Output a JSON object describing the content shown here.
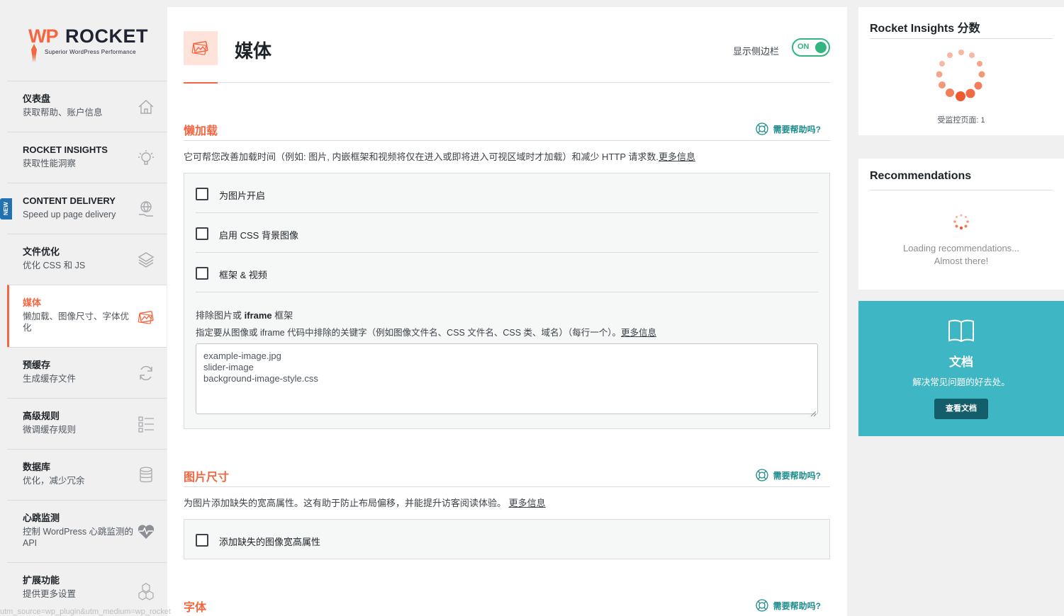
{
  "logo": {
    "wp": "WP",
    "rocket": "ROCKET",
    "tagline": "Superior WordPress Performance"
  },
  "sidebar": {
    "new_badge": "NEW",
    "items": [
      {
        "title": "仪表盘",
        "desc": "获取帮助、账户信息",
        "icon": "home-icon"
      },
      {
        "title": "ROCKET INSIGHTS",
        "desc": "获取性能洞察",
        "icon": "lightbulb-icon"
      },
      {
        "title": "CONTENT DELIVERY",
        "desc": "Speed up page delivery",
        "icon": "globe-hand-icon"
      },
      {
        "title": "文件优化",
        "desc": "优化 CSS 和 JS",
        "icon": "layers-icon"
      },
      {
        "title": "媒体",
        "desc": "懒加载、图像尺寸、字体优化",
        "icon": "images-icon"
      },
      {
        "title": "预缓存",
        "desc": "生成缓存文件",
        "icon": "refresh-icon"
      },
      {
        "title": "高级规则",
        "desc": "微调缓存规则",
        "icon": "list-icon"
      },
      {
        "title": "数据库",
        "desc": "优化，减少冗余",
        "icon": "database-icon"
      },
      {
        "title": "心跳监测",
        "desc": "控制 WordPress 心跳监测的 API",
        "icon": "heartbeat-icon"
      },
      {
        "title": "扩展功能",
        "desc": "提供更多设置",
        "icon": "cubes-icon"
      }
    ]
  },
  "header": {
    "title": "媒体",
    "toggle_label": "显示侧边栏",
    "toggle_state": "ON"
  },
  "help_label": "需要帮助吗?",
  "lazyload": {
    "title": "懒加载",
    "desc": "它可帮您改善加载时间（例如: 图片, 内嵌框架和视频将仅在进入或即将进入可视区域时才加载）和减少 HTTP 请求数.",
    "more": "更多信息",
    "options": [
      "为图片开启",
      "启用 CSS 背景图像",
      "框架 & 视频"
    ],
    "exclude_title_prefix": "排除图片或 ",
    "exclude_title_bold": "iframe",
    "exclude_title_suffix": " 框架",
    "exclude_desc": "指定要从图像或 iframe 代码中排除的关键字（例如图像文件名、CSS 文件名、CSS 类、域名）（每行一个）。",
    "exclude_more": "更多信息",
    "exclude_value": "example-image.jpg\nslider-image\nbackground-image-style.css"
  },
  "image_dimensions": {
    "title": "图片尺寸",
    "desc": "为图片添加缺失的宽高属性。这有助于防止布局偏移，并能提升访客阅读体验。",
    "more": "更多信息",
    "option": "添加缺失的图像宽高属性"
  },
  "fonts": {
    "title": "字体"
  },
  "insights_card": {
    "title": "Rocket Insights 分数",
    "monitored": "受监控页面: 1"
  },
  "recommendations_card": {
    "title": "Recommendations",
    "loading_line1": "Loading recommendations...",
    "loading_line2": "Almost there!"
  },
  "docs_card": {
    "title": "文档",
    "desc": "解决常见问题的好去处。",
    "button": "查看文档"
  },
  "status_bar_url": "utm_source=wp_plugin&utm_medium=wp_rocket",
  "colors": {
    "accent": "#f56640",
    "teal": "#3fb6c4",
    "toggle_green": "#32b581"
  }
}
